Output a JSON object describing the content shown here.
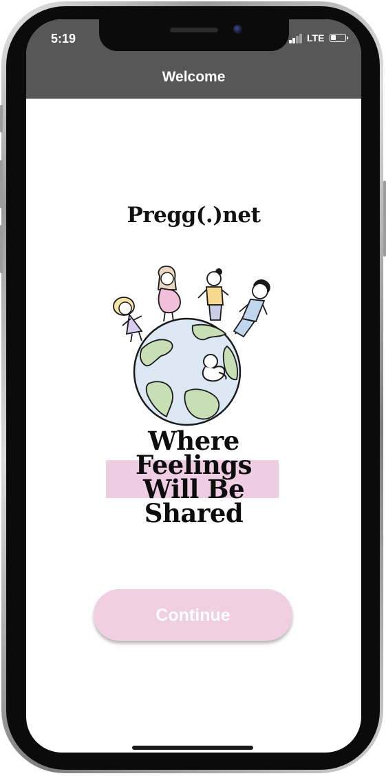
{
  "status_bar": {
    "time": "5:19",
    "network": "LTE"
  },
  "nav": {
    "title": "Welcome"
  },
  "logo": {
    "text": "Pregg(.)net"
  },
  "tagline": {
    "line1": "Where",
    "line2": "Feelings",
    "line3": "Will Be",
    "line4": "Shared"
  },
  "continue_button": {
    "label": "Continue"
  },
  "colors": {
    "nav_bar": "#575757",
    "accent_pink": "#efcde3",
    "globe_ocean": "#dde8f5",
    "globe_land": "#c8dfb5"
  }
}
